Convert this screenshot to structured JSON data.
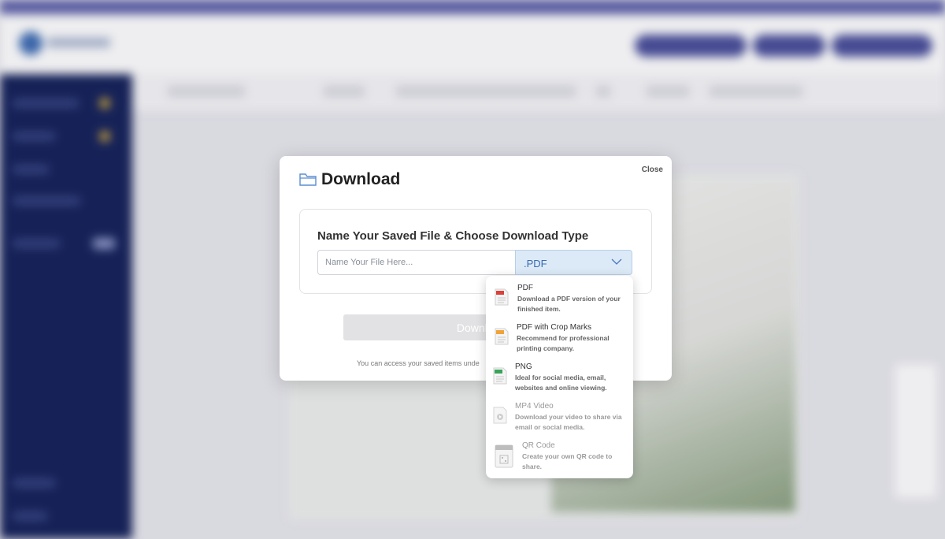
{
  "modal": {
    "title": "Download",
    "close_label": "Close",
    "section_title": "Name Your Saved File & Choose Download Type",
    "file_input": {
      "value": "",
      "placeholder": "Name Your File Here..."
    },
    "type_select": {
      "selected": ".PDF"
    },
    "download_button": "Download",
    "hint": "You can access your saved items unde"
  },
  "dropdown": {
    "options": [
      {
        "title": "PDF",
        "description": "Download a PDF version of your finished item.",
        "icon": "pdf-file-icon",
        "enabled": true
      },
      {
        "title": "PDF with Crop Marks",
        "description": "Recommend for professional printing company.",
        "icon": "pdf-crop-marks-file-icon",
        "enabled": true
      },
      {
        "title": "PNG",
        "description": "Ideal for social media, email, websites and online viewing.",
        "icon": "png-file-icon",
        "enabled": true
      },
      {
        "title": "MP4 Video",
        "description": "Download your video to share via email or social media.",
        "icon": "video-file-icon",
        "enabled": false
      },
      {
        "title": "QR Code",
        "description": "Create your own QR code to share.",
        "icon": "qr-code-icon",
        "enabled": false
      }
    ]
  },
  "colors": {
    "accent": "#3a6ab2",
    "select_bg": "#dceaf8",
    "sidebar": "#15225a",
    "top_strip": "#5b5ea8"
  }
}
